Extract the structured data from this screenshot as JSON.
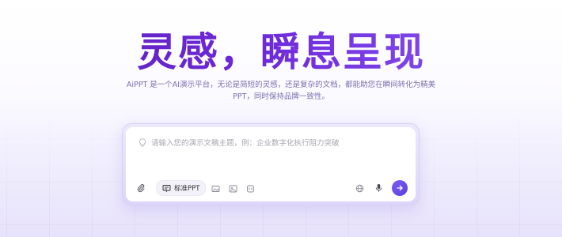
{
  "hero": {
    "title": "灵感，瞬息呈现",
    "subtitle": "AiPPT 是一个AI演示平台，无论是简短的灵感，还是复杂的文档，都能助您在瞬间转化为精美PPT，同时保持品牌一致性。"
  },
  "prompt": {
    "placeholder": "请输入您的演示文稿主题，例：企业数字化执行阻力突破",
    "value": ""
  },
  "toolbar": {
    "mode_selected": "标准PPT",
    "icons": [
      "paperclip-icon",
      "ppt-mode-icon",
      "image-icon",
      "picture-frame-icon",
      "template-icon",
      "globe-icon",
      "microphone-icon",
      "arrow-right-icon"
    ]
  },
  "colors": {
    "accent": "#6d28d9",
    "send_button": "#6a4ded",
    "subtitle_text": "#7c6fae"
  }
}
